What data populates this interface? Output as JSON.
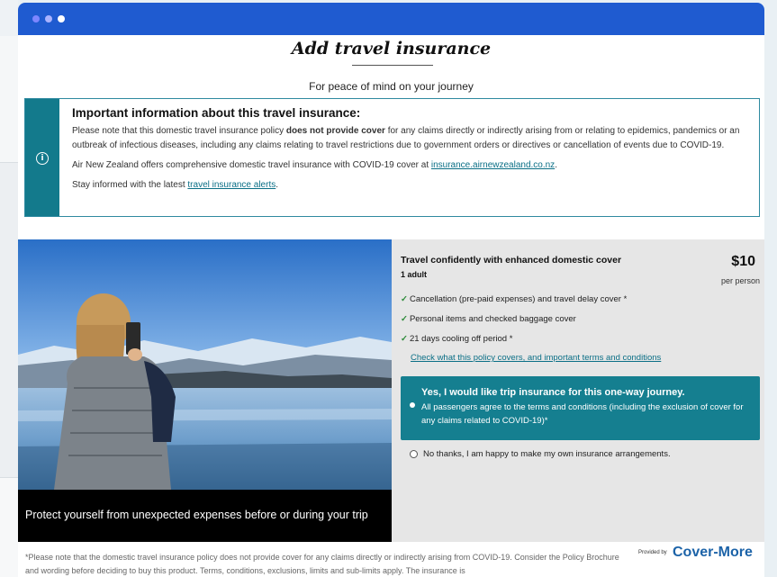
{
  "modal": {
    "title": "Add travel insurance",
    "subtitle": "For peace of mind on your journey"
  },
  "info": {
    "icon": "info-icon",
    "title": "Important information about this travel insurance:",
    "p1_before": "Please note that this domestic travel insurance policy ",
    "p1_bold": "does not provide cover",
    "p1_after": " for any claims directly or indirectly arising from or relating to epidemics, pandemics or an outbreak of infectious diseases, including any claims relating to travel restrictions due to government orders or directives or cancellation of events due to COVID-19.",
    "p2_before": "Air New Zealand offers comprehensive domestic travel insurance with COVID-19 cover at ",
    "p2_link": "insurance.airnewzealand.co.nz",
    "p2_after": ".",
    "p3_before": "Stay informed with the latest ",
    "p3_link": "travel insurance alerts",
    "p3_after": "."
  },
  "product": {
    "caption": "Protect yourself from unexpected expenses before or during your trip",
    "title": "Travel confidently with enhanced domestic cover",
    "passengers": "1 adult",
    "price": "$10",
    "price_unit": "per person",
    "features": [
      "Cancellation (pre-paid expenses) and travel delay cover *",
      "Personal items and checked baggage cover",
      "21 days cooling off period *"
    ],
    "policy_link": "Check what this policy covers, and important terms and conditions",
    "yes_title": "Yes, I would like trip insurance for this one-way journey.",
    "yes_text": "All passengers agree to the terms and conditions (including the exclusion of cover for any claims related to COVID-19)*",
    "no_text": "No thanks, I am happy to make my own insurance arrangements."
  },
  "footer": {
    "footnote": "*Please note that the domestic travel insurance policy does not provide cover for any claims directly or indirectly arising from COVID-19. Consider the Policy Brochure and wording before deciding to buy this product. Terms, conditions, exclusions, limits and sub-limits apply. The insurance is",
    "provided_by": "Provided by",
    "brand": "Cover-More"
  },
  "colors": {
    "titlebar": "#1f5bd0",
    "teal": "#157f90",
    "link": "#0b6f86",
    "brand": "#1c63a8"
  }
}
